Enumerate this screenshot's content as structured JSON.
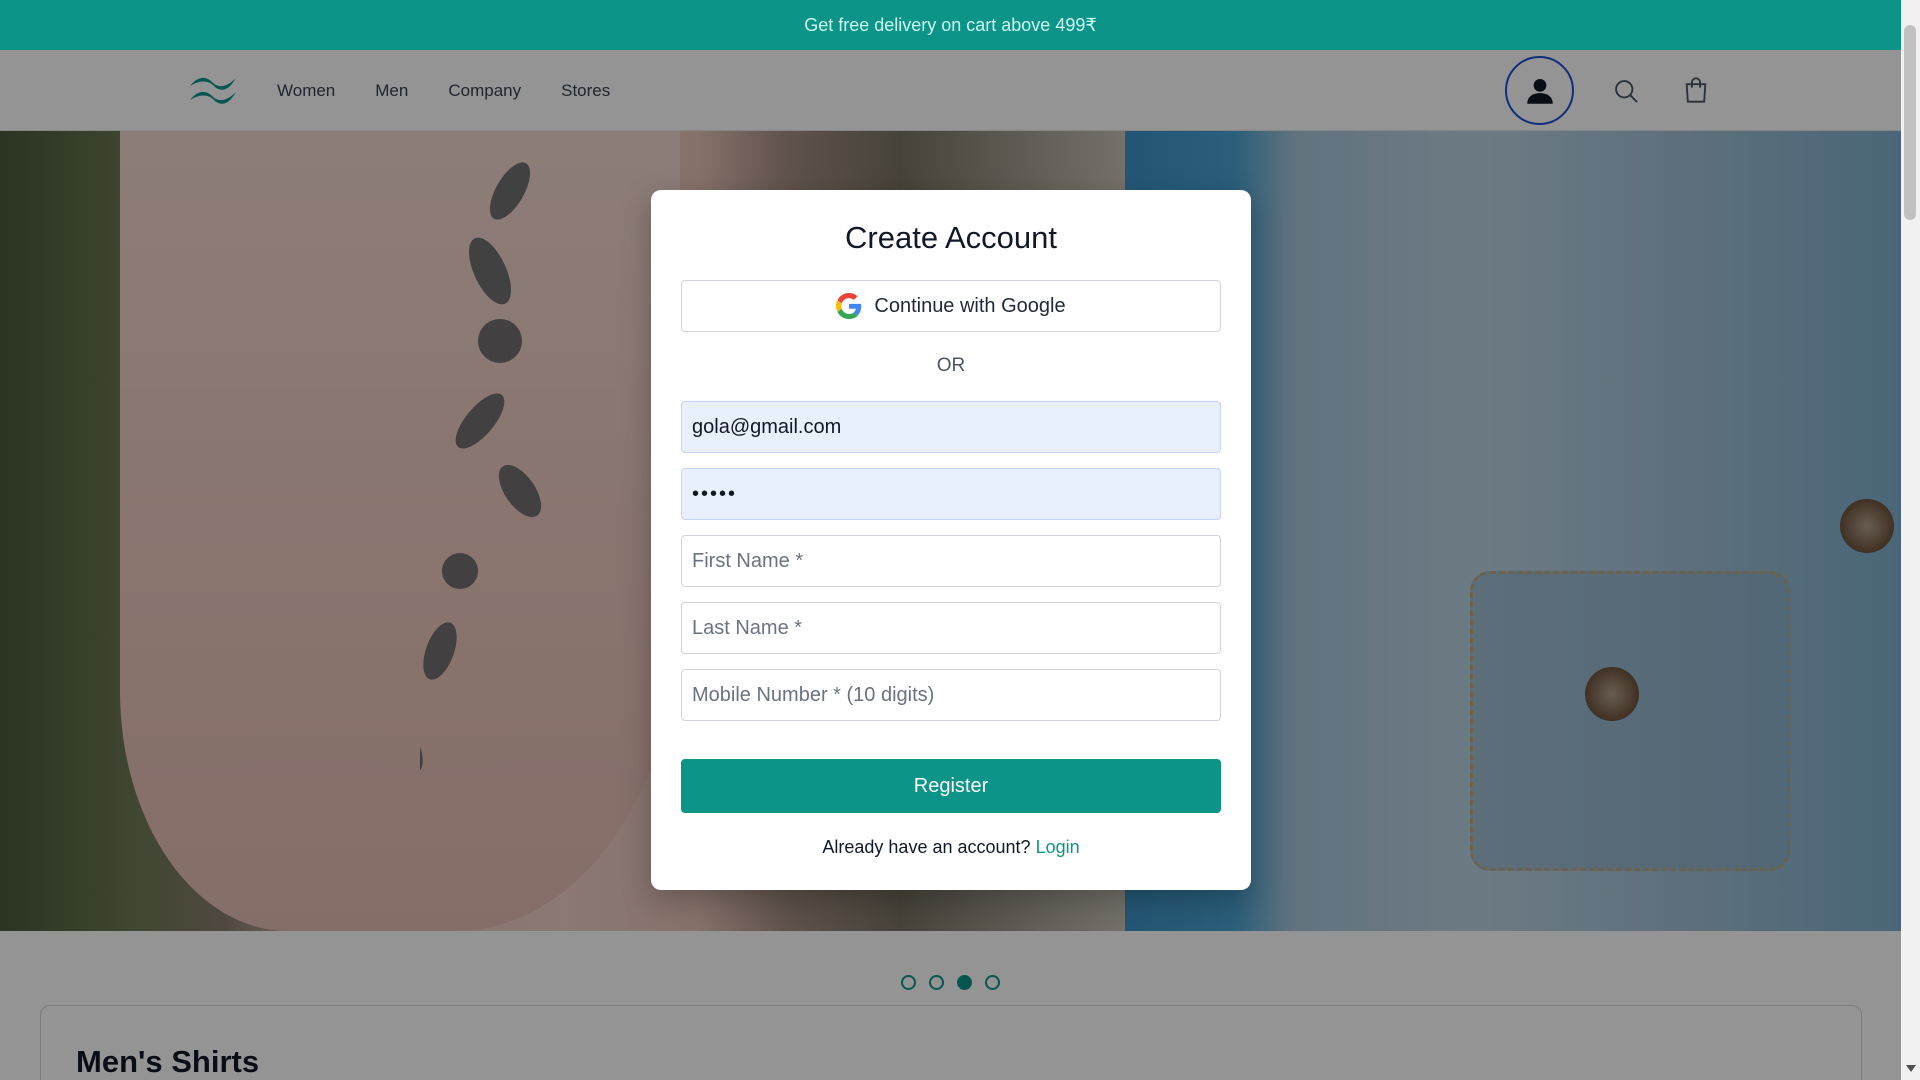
{
  "promo": {
    "text": "Get free delivery on cart above 499₹"
  },
  "header": {
    "logo_icon": "wave-logo-icon",
    "nav": [
      {
        "label": "Women"
      },
      {
        "label": "Men"
      },
      {
        "label": "Company"
      },
      {
        "label": "Stores"
      }
    ],
    "icons": {
      "account": "user-icon",
      "search": "search-icon",
      "cart": "shopping-bag-icon"
    }
  },
  "carousel": {
    "slide_count": 4,
    "active_index": 2
  },
  "section": {
    "title": "Men's Shirts"
  },
  "modal": {
    "title": "Create Account",
    "google_label": "Continue with Google",
    "or_label": "OR",
    "email_value": "gola@gmail.com",
    "password_value": "•••••",
    "first_name_placeholder": "First Name *",
    "last_name_placeholder": "Last Name *",
    "mobile_placeholder": "Mobile Number * (10 digits)",
    "register_label": "Register",
    "login_prompt": "Already have an account?",
    "login_link": "Login"
  },
  "colors": {
    "accent": "#0d9488",
    "account_ring": "#1d4ed8",
    "autofill_bg": "#e8f0fe"
  }
}
